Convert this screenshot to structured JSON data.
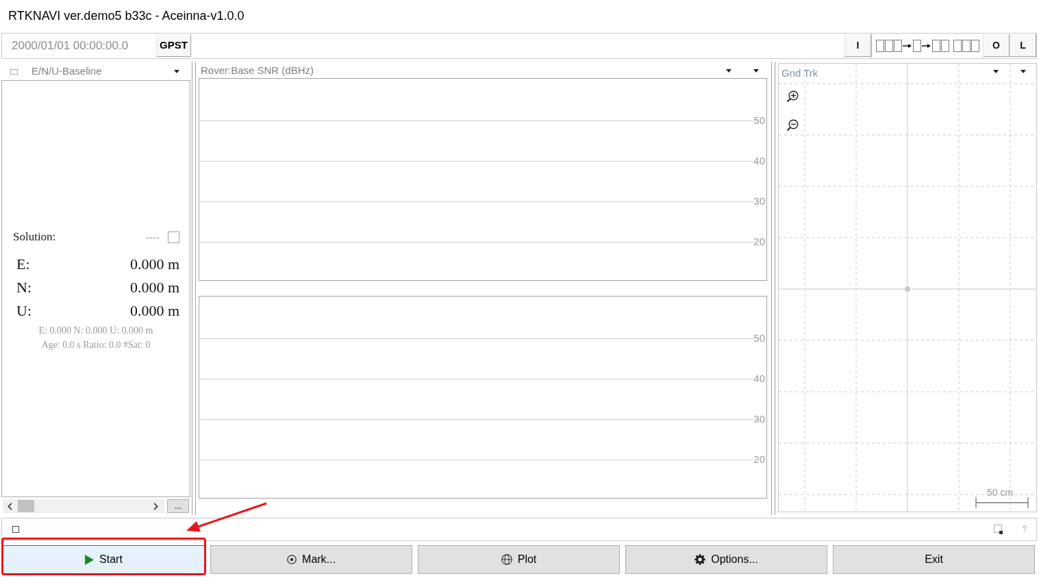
{
  "window": {
    "title": "RTKNAVI ver.demo5 b33c - Aceinna-v1.0.0"
  },
  "time_bar": {
    "time": "2000/01/01 00:00:00.0",
    "time_system_button": "GPST",
    "input_button": "I",
    "output_button": "O",
    "log_button": "L"
  },
  "solution_panel": {
    "view": "E/N/U-Baseline",
    "solution_label": "Solution:",
    "solution_status": "----",
    "coordinates": [
      {
        "axis": "E:",
        "value": "0.000 m"
      },
      {
        "axis": "N:",
        "value": "0.000 m"
      },
      {
        "axis": "U:",
        "value": "0.000 m"
      }
    ],
    "summary_lines": [
      "E: 0.000 N: 0.000 U: 0.000 m",
      "Age: 0.0 s Ratio: 0.0 #Sat: 0"
    ],
    "more_button": "..."
  },
  "snr_panel": {
    "title": "Rover:Base SNR (dBHz)",
    "plots": [
      {
        "y_ticks": [
          "50",
          "40",
          "30",
          "20"
        ]
      },
      {
        "y_ticks": [
          "50",
          "40",
          "30",
          "20"
        ]
      }
    ]
  },
  "ground_track": {
    "title": "Gnd Trk",
    "scale_label": "50 cm"
  },
  "status_bar": {
    "help": "?"
  },
  "buttons": [
    {
      "kind": "start",
      "label": "Start",
      "focused": true,
      "highlighted": true
    },
    {
      "kind": "mark",
      "label": "Mark...",
      "focused": false,
      "highlighted": false
    },
    {
      "kind": "plot",
      "label": "Plot",
      "focused": false,
      "highlighted": false
    },
    {
      "kind": "options",
      "label": "Options...",
      "focused": false,
      "highlighted": false
    },
    {
      "kind": "exit",
      "label": "Exit",
      "focused": false,
      "highlighted": false
    }
  ],
  "pointer_arrow": true
}
